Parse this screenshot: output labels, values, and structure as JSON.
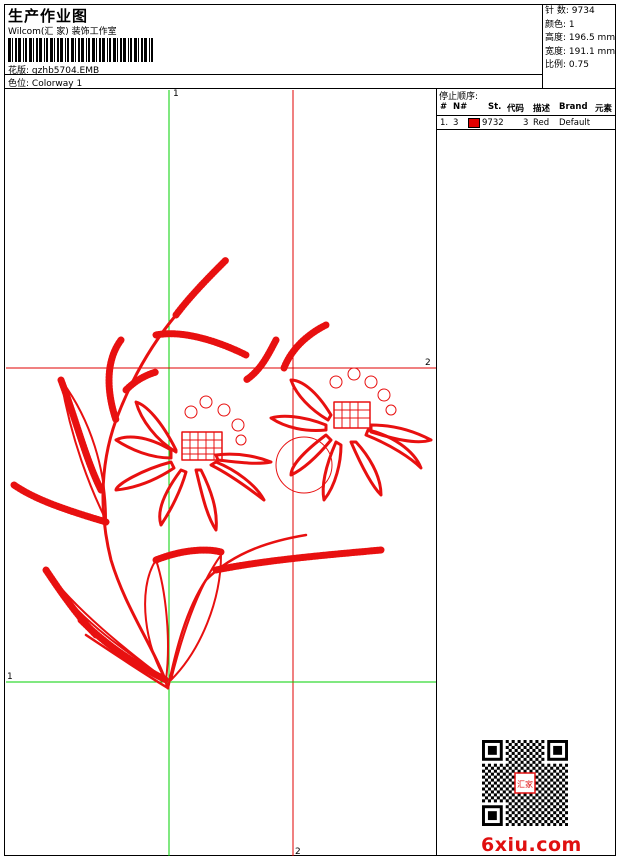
{
  "header": {
    "title": "生产作业图",
    "company": "Wilcom(汇 家) 装饰工作室",
    "design_label": "花版:",
    "design_file": "gzhb5704.EMB",
    "colorway_label": "色位:",
    "colorway": "Colorway 1"
  },
  "stats": [
    {
      "label": "针 数:",
      "value": "9734"
    },
    {
      "label": "颜色:",
      "value": "1"
    },
    {
      "label": "高度:",
      "value": "196.5 mm"
    },
    {
      "label": "宽度:",
      "value": "191.1 mm"
    },
    {
      "label": "比例:",
      "value": "0.75"
    }
  ],
  "stop_sequence": {
    "title": "停止顺序:",
    "columns": [
      "#",
      "N#",
      "St.",
      "代码",
      "描述",
      "Brand",
      "元素"
    ],
    "rows": [
      {
        "index": "1.",
        "needle": "3",
        "color_hex": "#e00000",
        "code": "9732",
        "stitches": "3",
        "description": "Red",
        "brand": "Default"
      }
    ]
  },
  "guides": {
    "h1_label": "1",
    "h2_label": "2",
    "v1_label": "1",
    "v2_label": "2"
  },
  "colors": {
    "thread": "#e81010",
    "guide_green": "#00d000",
    "guide_red": "#e00000"
  },
  "watermark": {
    "text": "6xiu.com",
    "stamp_text": "汇家"
  }
}
